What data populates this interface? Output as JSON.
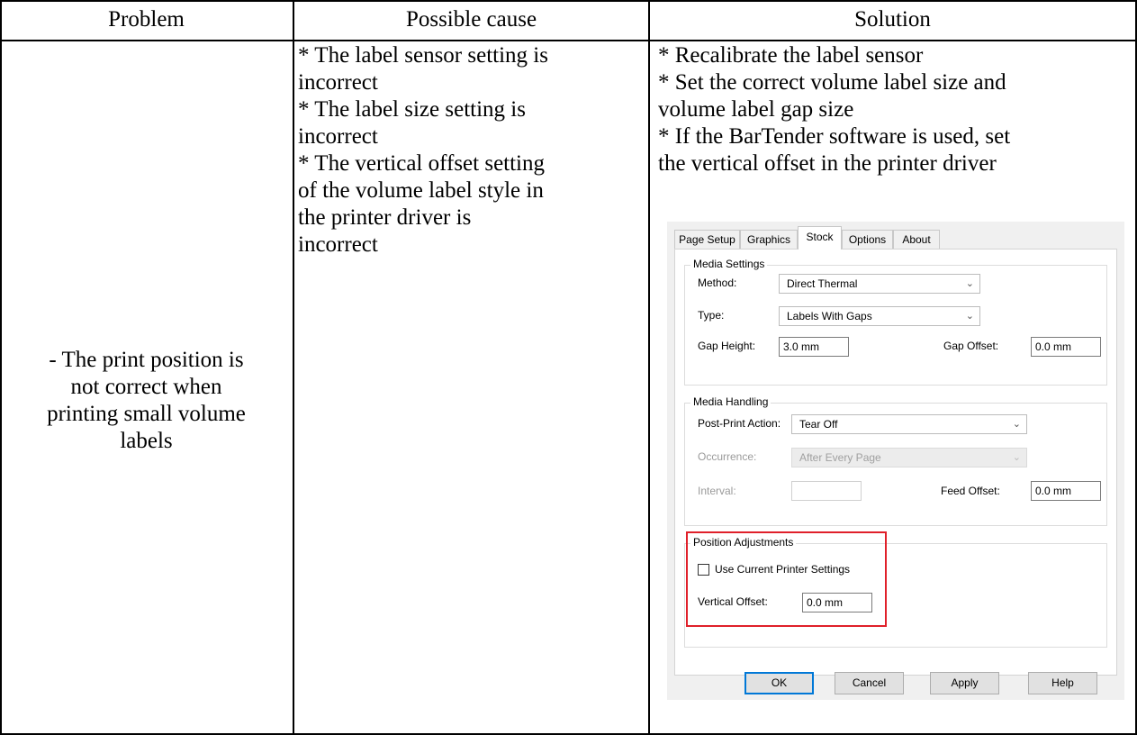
{
  "table": {
    "headers": [
      "Problem",
      "Possible cause",
      "Solution"
    ],
    "problem": "- The print position is\nnot correct when\nprinting small volume\nlabels",
    "cause": "* The label sensor setting is\nincorrect\n* The label size setting is\nincorrect\n* The vertical offset setting\nof the volume label style in\nthe printer driver is\nincorrect",
    "solution": "* Recalibrate the label sensor\n* Set the correct volume label size and\nvolume label gap size\n* If the BarTender software is used, set\nthe vertical offset in the printer driver"
  },
  "dialog": {
    "tabs": [
      "Page Setup",
      "Graphics",
      "Stock",
      "Options",
      "About"
    ],
    "active_tab": "Stock",
    "media_settings": {
      "title": "Media Settings",
      "method_label": "Method:",
      "method_value": "Direct Thermal",
      "type_label": "Type:",
      "type_value": "Labels With Gaps",
      "gap_height_label": "Gap Height:",
      "gap_height_value": "3.0 mm",
      "gap_offset_label": "Gap Offset:",
      "gap_offset_value": "0.0 mm"
    },
    "media_handling": {
      "title": "Media Handling",
      "post_print_label": "Post-Print Action:",
      "post_print_value": "Tear Off",
      "occurrence_label": "Occurrence:",
      "occurrence_value": "After Every Page",
      "interval_label": "Interval:",
      "interval_value": "",
      "feed_offset_label": "Feed Offset:",
      "feed_offset_value": "0.0 mm"
    },
    "position_adjustments": {
      "title": "Position Adjustments",
      "use_current_label": "Use Current Printer Settings",
      "use_current_checked": false,
      "vertical_offset_label": "Vertical Offset:",
      "vertical_offset_value": "0.0 mm"
    },
    "buttons": [
      "OK",
      "Cancel",
      "Apply",
      "Help"
    ],
    "highlight_color": "#e0202a"
  }
}
